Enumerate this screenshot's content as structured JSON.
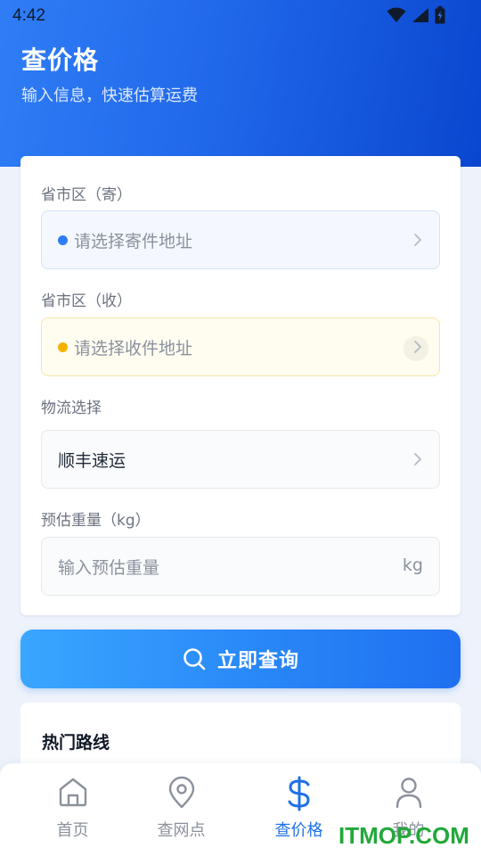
{
  "status_bar": {
    "time": "4:42"
  },
  "header": {
    "title": "查价格",
    "subtitle": "输入信息，快速估算运费"
  },
  "form": {
    "sender": {
      "label": "省市区（寄）",
      "placeholder": "请选择寄件地址",
      "dot_color": "#2f7df6"
    },
    "receiver": {
      "label": "省市区（收）",
      "placeholder": "请选择收件地址",
      "dot_color": "#f5b300"
    },
    "logistics": {
      "label": "物流选择",
      "value": "顺丰速运"
    },
    "weight": {
      "label": "预估重量（kg）",
      "placeholder": "输入预估重量",
      "unit": "kg"
    }
  },
  "query_button": {
    "label": "立即查询",
    "icon": "search-icon"
  },
  "hot_routes": {
    "title": "热门路线"
  },
  "bottom_nav": {
    "items": [
      {
        "label": "首页",
        "icon": "home-icon",
        "active": false
      },
      {
        "label": "查网点",
        "icon": "location-pin-icon",
        "active": false
      },
      {
        "label": "查价格",
        "icon": "dollar-icon",
        "active": true
      },
      {
        "label": "我的",
        "icon": "user-icon",
        "active": false
      }
    ],
    "active_color": "#1f6fe8"
  },
  "watermark": "ITMOP.COM"
}
